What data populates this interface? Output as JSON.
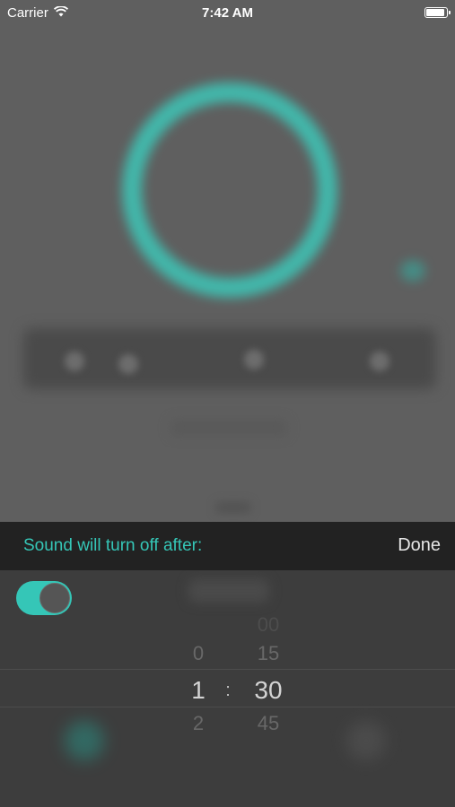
{
  "status_bar": {
    "carrier": "Carrier",
    "time": "7:42 AM",
    "wifi_icon": "wifi-icon",
    "battery_icon": "battery-icon"
  },
  "sheet": {
    "title": "Sound will turn off after:",
    "done_label": "Done",
    "toggle_on": true,
    "accent_color": "#35c6b7"
  },
  "picker": {
    "hours": [
      "0",
      "1",
      "2"
    ],
    "minutes": [
      "00",
      "15",
      "30",
      "45"
    ],
    "selected_hour": "1",
    "selected_minute": "30",
    "separator": ":"
  }
}
